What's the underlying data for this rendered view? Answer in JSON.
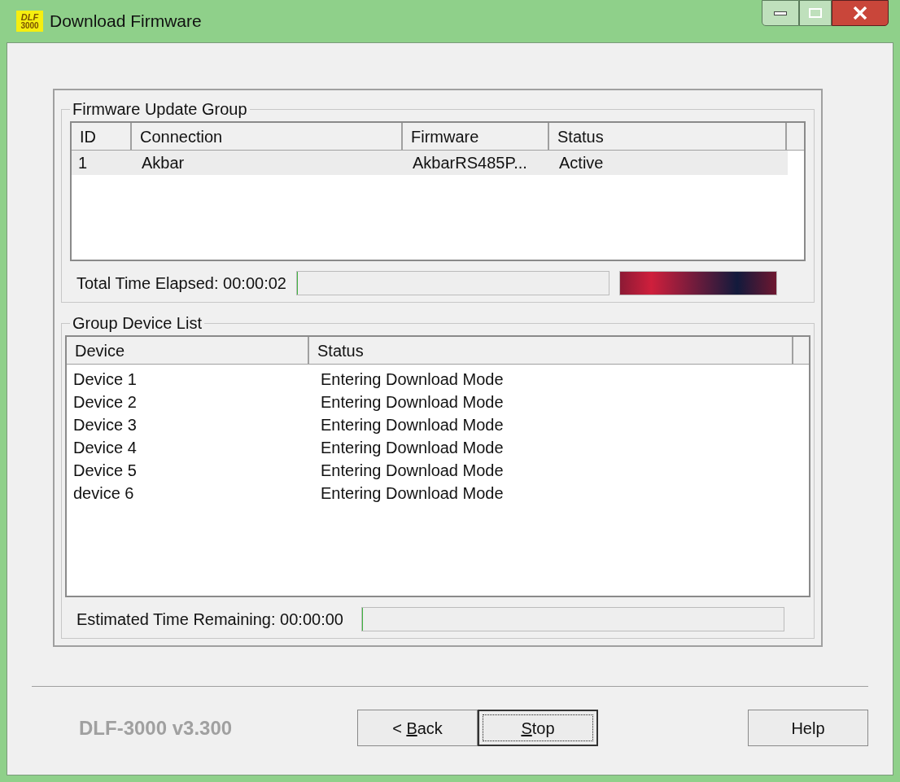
{
  "window": {
    "title": "Download Firmware",
    "app_icon": {
      "line_1": "DLF",
      "line_2": "3000"
    }
  },
  "firmware_update_group": {
    "title": "Firmware Update Group",
    "columns": [
      "ID",
      "Connection",
      "Firmware",
      "Status"
    ],
    "rows": [
      {
        "id": "1",
        "connection": "Akbar",
        "firmware": "AkbarRS485P...",
        "status": "Active",
        "selected": true
      }
    ],
    "elapsed": {
      "label": "Total Time Elapsed: 00:00:02",
      "level": 0,
      "marquee": true
    }
  },
  "group_device_list": {
    "title": "Group Device List",
    "columns": [
      "Device",
      "Status"
    ],
    "rows": [
      {
        "device": "Device 1",
        "status": "Entering Download Mode"
      },
      {
        "device": "Device 2",
        "status": "Entering Download Mode"
      },
      {
        "device": "Device 3",
        "status": "Entering Download Mode"
      },
      {
        "device": "Device 4",
        "status": "Entering Download Mode"
      },
      {
        "device": "Device 5",
        "status": "Entering Download Mode"
      },
      {
        "device": "device 6",
        "status": "Entering Download Mode"
      }
    ],
    "remaining": {
      "label": "Estimated Time Remaining: 00:00:00",
      "level": 0
    }
  },
  "version": "DLF-3000 v3.300",
  "buttons": [
    {
      "before": "< ",
      "mnemonic": "B",
      "after": "ack",
      "focused": false
    },
    {
      "mnemonic": "S",
      "after": "top",
      "focused": true
    },
    {
      "before": "Help",
      "focused": false
    }
  ]
}
